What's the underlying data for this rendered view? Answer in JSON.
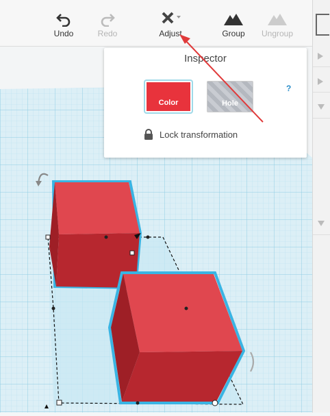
{
  "toolbar": {
    "undo": "Undo",
    "redo": "Redo",
    "adjust": "Adjust",
    "group": "Group",
    "ungroup": "Ungroup"
  },
  "inspector": {
    "title": "Inspector",
    "color_label": "Color",
    "hole_label": "Hole",
    "help": "?",
    "lock_label": "Lock transformation"
  },
  "colors": {
    "shape_red": "#e8333c",
    "selection_blue": "#3ab4e3",
    "annotation_arrow": "#e03a3a"
  }
}
